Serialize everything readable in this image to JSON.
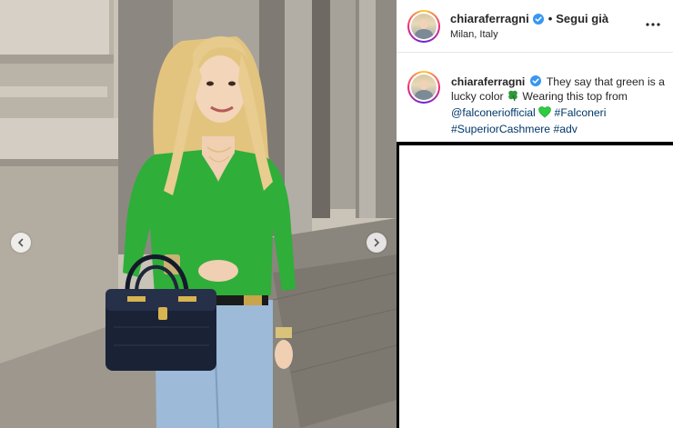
{
  "post": {
    "username": "chiaraferragni",
    "follow_label": "Segui già",
    "separator": "•",
    "location": "Milan, Italy",
    "more_icon": "more-horizontal-icon"
  },
  "caption": {
    "username": "chiaraferragni",
    "text_1": "They say that green is a lucky color",
    "text_2": "Wearing this top from",
    "mention": "@falconeriofficial",
    "hashtags": [
      "#Falconeri",
      "#SuperiorCashmere",
      "#adv"
    ]
  },
  "colors": {
    "verified_blue": "#3897f0",
    "link_blue": "#00376b",
    "sweater_green": "#2fae3a",
    "heart_green": "#2ecc40"
  },
  "icons": {
    "prev": "chevron-left-icon",
    "next": "chevron-right-icon",
    "verified": "verified-badge-icon",
    "clover": "four-leaf-clover-icon",
    "heart": "green-heart-icon"
  }
}
